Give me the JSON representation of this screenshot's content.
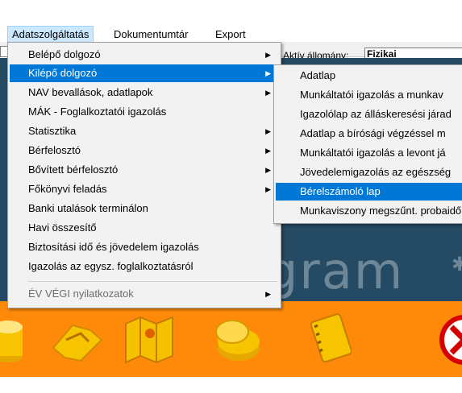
{
  "menubar": {
    "items": [
      {
        "label": "Adatszolgáltatás"
      },
      {
        "label": "Dokumentumtár"
      },
      {
        "label": "Export"
      }
    ]
  },
  "status": {
    "aktiv_label": "Aktív állomány:",
    "aktiv_value": "Fizikai"
  },
  "background": {
    "brand_text": "gram"
  },
  "menu_main": {
    "items": [
      {
        "label": "Belépő dolgozó",
        "submenu": true
      },
      {
        "label": "Kilépő dolgozó",
        "submenu": true
      },
      {
        "label": "NAV bevallások, adatlapok",
        "submenu": true
      },
      {
        "label": "MÁK - Foglalkoztatói igazolás",
        "submenu": false
      },
      {
        "label": "Statisztika",
        "submenu": true
      },
      {
        "label": "Bérfelosztó",
        "submenu": true
      },
      {
        "label": "Bővített bérfelosztó",
        "submenu": true
      },
      {
        "label": "Főkönyvi feladás",
        "submenu": true
      },
      {
        "label": "Banki utalások terminálon",
        "submenu": false
      },
      {
        "label": "Havi összesítő",
        "submenu": false
      },
      {
        "label": "Biztosítási idő és jövedelem igazolás",
        "submenu": false
      },
      {
        "label": "Igazolás az egysz. foglalkoztatásról",
        "submenu": false
      },
      {
        "label": "ÉV VÉGI nyilatkozatok",
        "submenu": true
      }
    ]
  },
  "menu_sub": {
    "items": [
      {
        "label": "Adatlap"
      },
      {
        "label": "Munkáltatói igazolás a munkav"
      },
      {
        "label": "Igazolólap az álláskeresési járad"
      },
      {
        "label": "Adatlap a bírósági végzéssel m"
      },
      {
        "label": "Munkáltatói igazolás a levont já"
      },
      {
        "label": "Jövedelemigazolás az egészség"
      },
      {
        "label": "Bérelszámoló lap"
      },
      {
        "label": "Munkaviszony megszűnt. probaidő"
      }
    ]
  },
  "colors": {
    "highlight": "#0078d7",
    "desktop_bg": "#254a63",
    "toolbar_orange": "#ff8a0a"
  }
}
